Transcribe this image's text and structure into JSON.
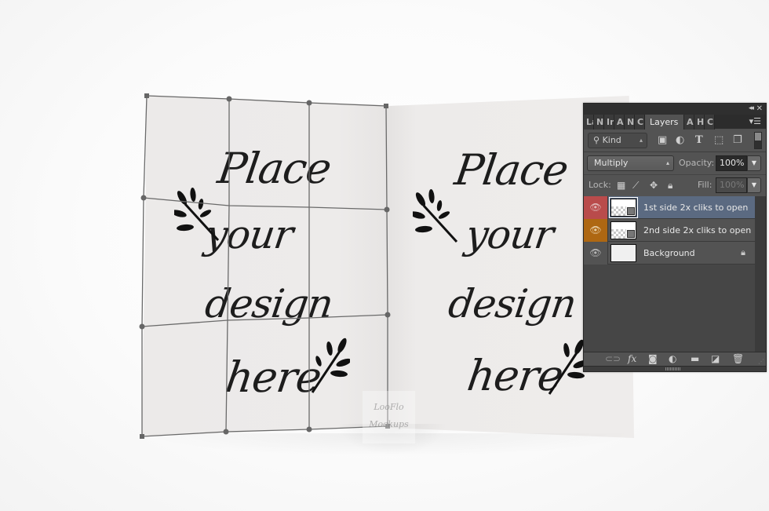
{
  "document": {
    "left_page": {
      "lines": [
        "Place",
        "your",
        "design",
        "here"
      ]
    },
    "right_page": {
      "lines": [
        "Place",
        "your",
        "design",
        "here"
      ]
    },
    "watermark": [
      "LooFlo",
      "Mockups"
    ],
    "tool_state": "warp-transform",
    "warp_grid": "3x3"
  },
  "layers_panel": {
    "titlebar": {
      "collapse_label": "◂◂",
      "close_label": "✕"
    },
    "tabs": [
      {
        "label": "La",
        "active": false
      },
      {
        "label": "N",
        "active": false
      },
      {
        "label": "In",
        "active": false
      },
      {
        "label": "A",
        "active": false
      },
      {
        "label": "N",
        "active": false
      },
      {
        "label": "Cl",
        "active": false
      },
      {
        "label": "Layers",
        "active": true
      },
      {
        "label": "A",
        "active": false
      },
      {
        "label": "H",
        "active": false
      },
      {
        "label": "Cl",
        "active": false
      }
    ],
    "panel_menu_icon": "menu-icon",
    "filter": {
      "kind_label": "Kind",
      "search_icon": "search-icon",
      "filter_icons": [
        "image-icon",
        "adjustment-icon",
        "type-icon",
        "shape-icon",
        "smart-object-icon"
      ]
    },
    "blend_mode": "Multiply",
    "opacity_label": "Opacity:",
    "opacity_value": "100%",
    "lock_label": "Lock:",
    "lock_icons": [
      "lock-transparent-icon",
      "lock-paint-icon",
      "lock-position-icon",
      "lock-all-icon"
    ],
    "fill_label": "Fill:",
    "fill_value": "100%",
    "layers": [
      {
        "name": "1st side 2x cliks to open",
        "visible": true,
        "selected": true,
        "color": "#b94b4b",
        "type": "smart-object"
      },
      {
        "name": "2nd side 2x cliks to open",
        "visible": true,
        "selected": false,
        "color": "#ae6712",
        "type": "smart-object"
      },
      {
        "name": "Background",
        "visible": true,
        "selected": false,
        "color": "none",
        "type": "background",
        "locked": true
      }
    ],
    "footer_icons": [
      "link-icon",
      "fx-icon",
      "mask-icon",
      "adjustment-layer-icon",
      "group-folder-icon",
      "new-layer-icon",
      "trash-icon"
    ]
  },
  "colors": {
    "panel_bg": "#535353",
    "selected_layer": "#5b6a81",
    "label_red": "#b94b4b",
    "label_orange": "#ae6712"
  }
}
